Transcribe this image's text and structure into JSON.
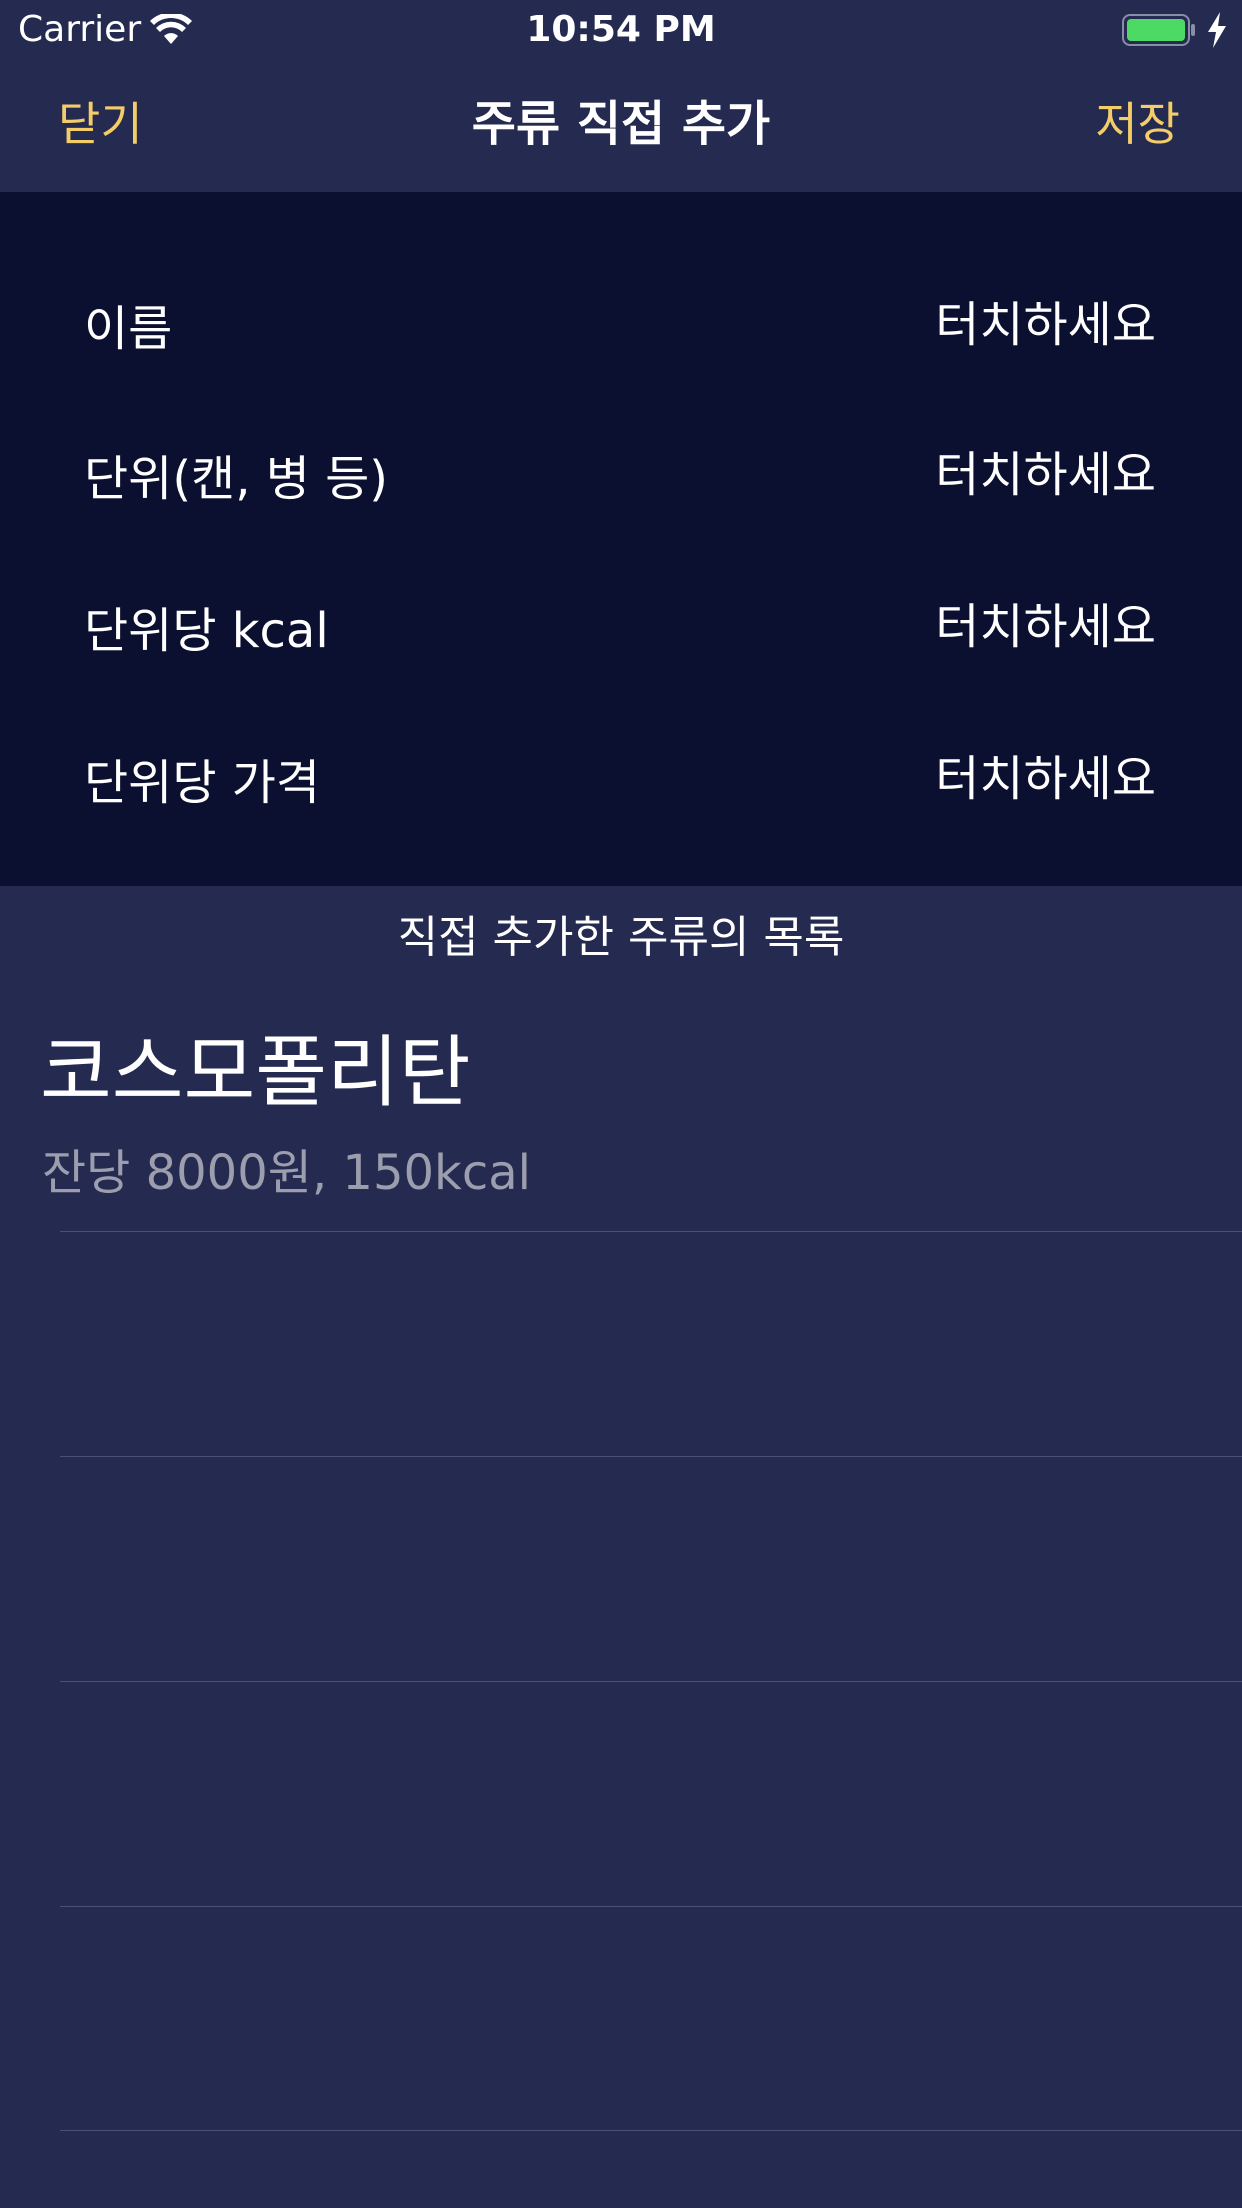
{
  "status_bar": {
    "carrier": "Carrier",
    "time": "10:54 PM",
    "wifi_icon": "wifi-icon",
    "battery_icon": "battery-icon",
    "charging_icon": "charging-bolt-icon",
    "battery_color": "#4cd964"
  },
  "nav": {
    "close_label": "닫기",
    "title": "주류 직접 추가",
    "save_label": "저장",
    "accent_color": "#f5cd68"
  },
  "form": {
    "rows": [
      {
        "label": "이름",
        "value": "터치하세요"
      },
      {
        "label": "단위(캔, 병 등)",
        "value": "터치하세요"
      },
      {
        "label": "단위당 kcal",
        "value": "터치하세요"
      },
      {
        "label": "단위당 가격",
        "value": "터치하세요"
      }
    ]
  },
  "list": {
    "header": "직접 추가한 주류의 목록",
    "items": [
      {
        "title": "코스모폴리탄",
        "subtitle": "잔당 8000원, 150kcal"
      }
    ]
  },
  "colors": {
    "background": "#252a50",
    "form_background": "#0b1030",
    "subtitle": "#9c9eae",
    "separator": "#4a5078"
  }
}
